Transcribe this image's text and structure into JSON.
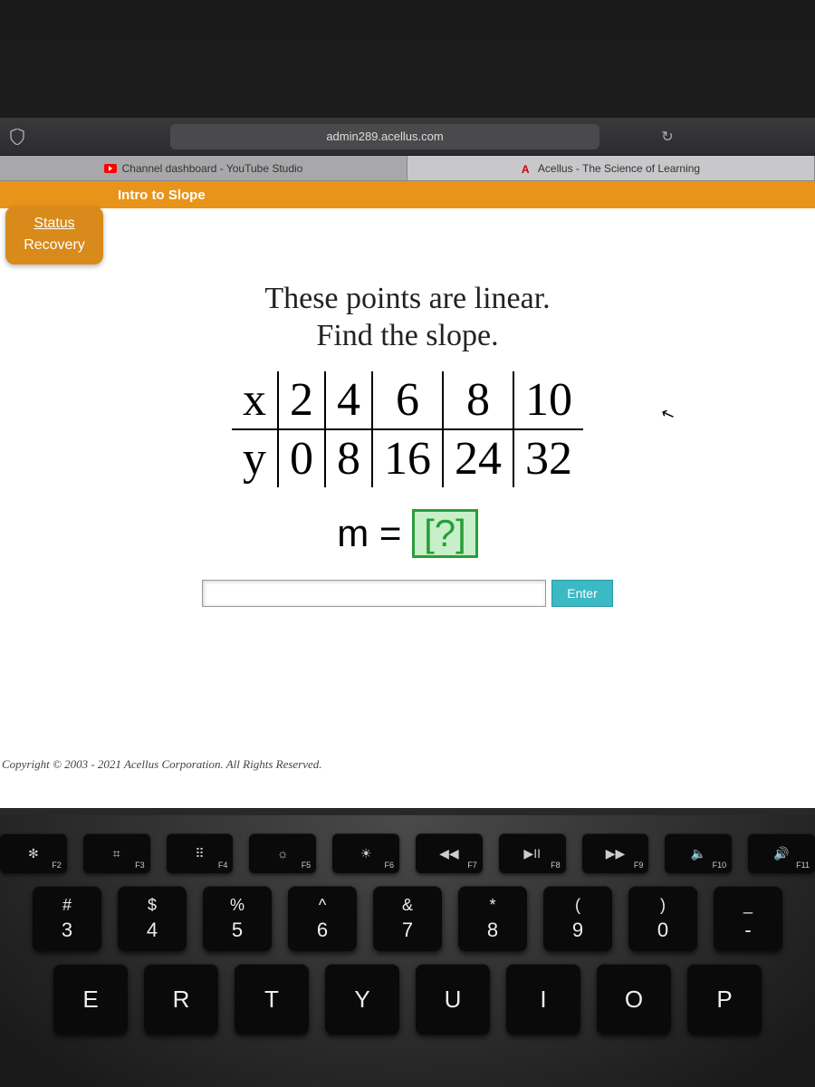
{
  "browser": {
    "address": "admin289.acellus.com",
    "tabs": [
      {
        "label": "Channel dashboard - YouTube Studio"
      },
      {
        "label": "Acellus - The Science of Learning"
      }
    ]
  },
  "lesson": {
    "title": "Intro to Slope"
  },
  "sidebar": {
    "line1": "Status",
    "line2": "Recovery"
  },
  "problem": {
    "prompt_line1": "These points are linear.",
    "prompt_line2": "Find the slope.",
    "row_x_label": "x",
    "row_y_label": "y",
    "equation_lhs": "m =",
    "answer_placeholder": "[?]",
    "enter_label": "Enter"
  },
  "chart_data": {
    "type": "table",
    "title": "These points are linear. Find the slope.",
    "columns": [
      "x",
      "y"
    ],
    "x": [
      2,
      4,
      6,
      8,
      10
    ],
    "y": [
      0,
      8,
      16,
      24,
      32
    ]
  },
  "footer": {
    "copyright": "Copyright © 2003 - 2021 Acellus Corporation. All Rights Reserved."
  },
  "keyboard": {
    "frow": [
      {
        "icon": "✻",
        "label": "F2"
      },
      {
        "icon": "⌗",
        "label": "F3"
      },
      {
        "icon": "⠿",
        "label": "F4"
      },
      {
        "icon": "☼",
        "label": "F5"
      },
      {
        "icon": "☀",
        "label": "F6"
      },
      {
        "icon": "◀◀",
        "label": "F7"
      },
      {
        "icon": "▶II",
        "label": "F8"
      },
      {
        "icon": "▶▶",
        "label": "F9"
      },
      {
        "icon": "🔈",
        "label": "F10"
      },
      {
        "icon": "🔊",
        "label": "F11"
      }
    ],
    "numrow": [
      {
        "sym": "#",
        "num": "3"
      },
      {
        "sym": "$",
        "num": "4"
      },
      {
        "sym": "%",
        "num": "5"
      },
      {
        "sym": "^",
        "num": "6"
      },
      {
        "sym": "&",
        "num": "7"
      },
      {
        "sym": "*",
        "num": "8"
      },
      {
        "sym": "(",
        "num": "9"
      },
      {
        "sym": ")",
        "num": "0"
      },
      {
        "sym": "_",
        "num": "-"
      }
    ],
    "letterrow": [
      "E",
      "R",
      "T",
      "Y",
      "U",
      "I",
      "O",
      "P"
    ]
  }
}
